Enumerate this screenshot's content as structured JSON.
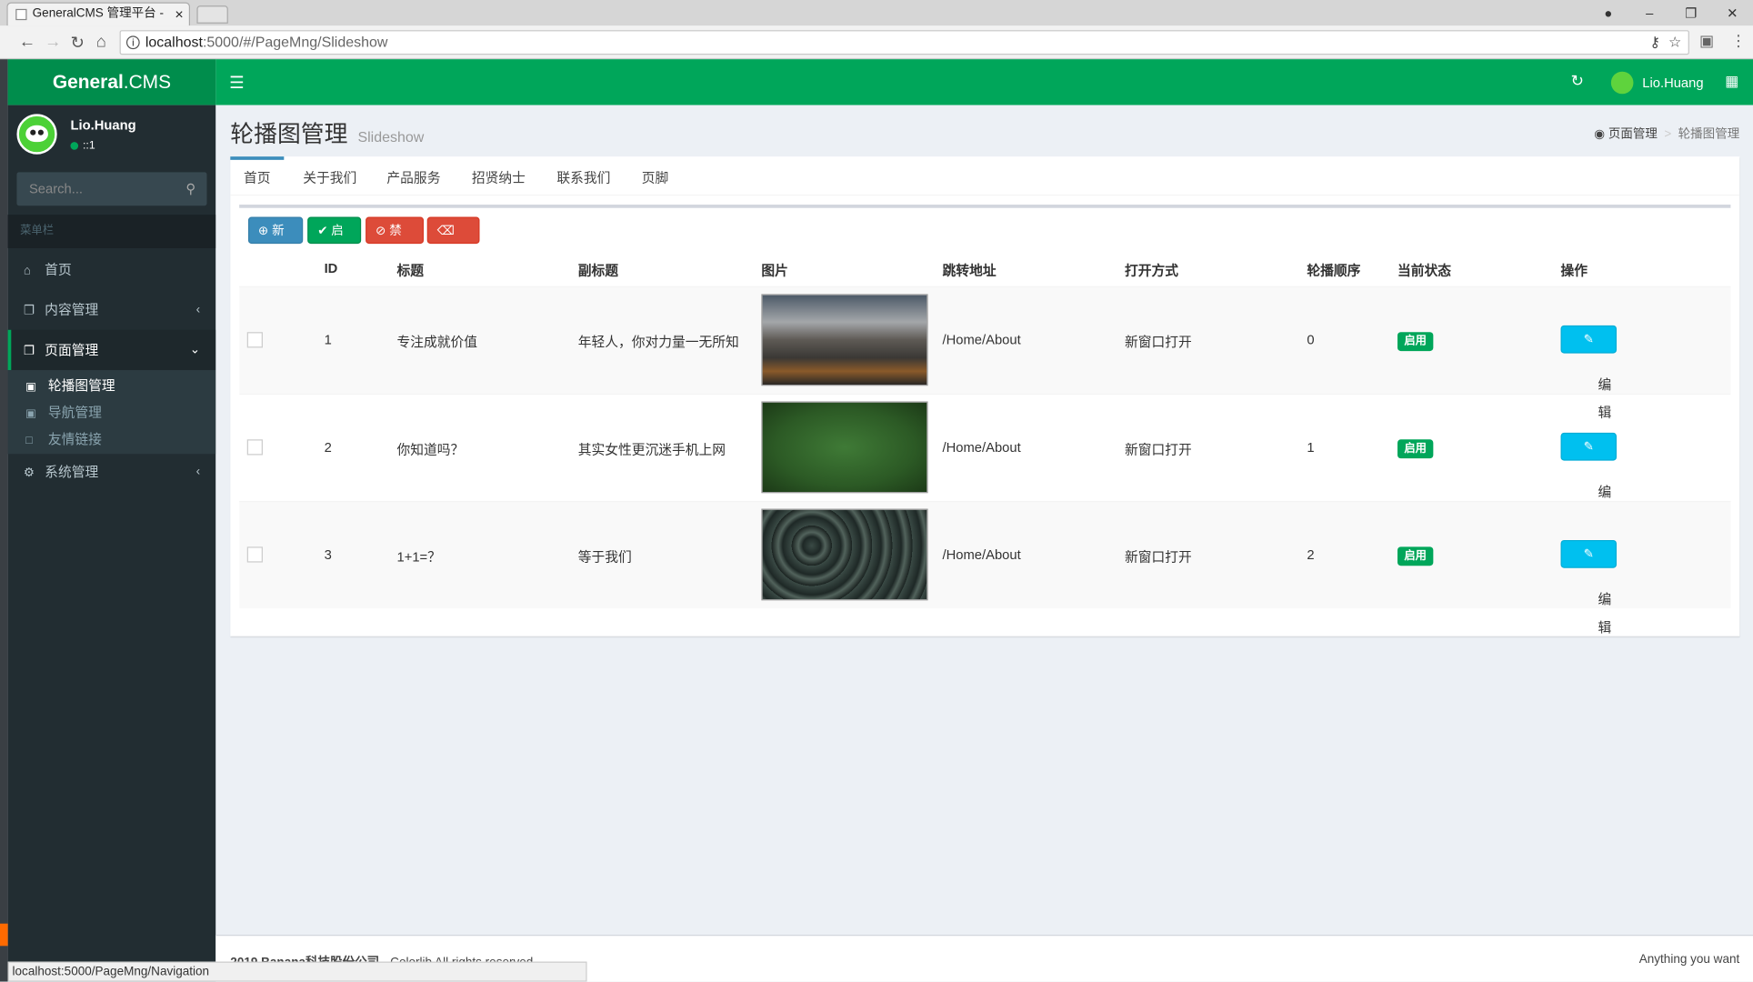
{
  "browser": {
    "tab_title": "GeneralCMS 管理平台 -",
    "tab_close": "×",
    "url_host": "localhost",
    "url_path": ":5000/#/PageMng/Slideshow",
    "status_url": "localhost:5000/PageMng/Navigation"
  },
  "app": {
    "brand_bold": "General",
    "brand_rest": ".CMS",
    "user_name": "Lio.Huang",
    "user_status": "::1",
    "search_placeholder": "Search..."
  },
  "sidebar": {
    "header": "菜单栏",
    "items": [
      {
        "label": "首页",
        "icon": "home-icon"
      },
      {
        "label": "内容管理",
        "icon": "clone-icon"
      },
      {
        "label": "页面管理",
        "icon": "clone-icon"
      },
      {
        "label": "系统管理",
        "icon": "cogs-icon"
      }
    ],
    "sub_items": [
      {
        "label": "轮播图管理",
        "icon": "image-icon"
      },
      {
        "label": "导航管理",
        "icon": "image-icon"
      },
      {
        "label": "友情链接",
        "icon": "file-icon"
      }
    ]
  },
  "page": {
    "title": "轮播图管理",
    "subtitle": "Slideshow",
    "breadcrumb": [
      "页面管理",
      "轮播图管理"
    ]
  },
  "tabs": [
    "首页",
    "关于我们",
    "产品服务",
    "招贤纳士",
    "联系我们",
    "页脚"
  ],
  "toolbar": {
    "add": "新增",
    "enable": "启用",
    "disable": "禁用",
    "delete": "删除"
  },
  "table": {
    "headers": [
      "ID",
      "标题",
      "副标题",
      "图片",
      "跳转地址",
      "打开方式",
      "轮播顺序",
      "当前状态",
      "操作"
    ],
    "rows": [
      {
        "id": "1",
        "title": "专注成就价值",
        "subtitle": "年轻人，你对力量一无所知",
        "link": "/Home/About",
        "open": "新窗口打开",
        "order": "0",
        "status": "启用",
        "action": "编辑"
      },
      {
        "id": "2",
        "title": "你知道吗？",
        "subtitle": "其实女性更沉迷手机上网",
        "link": "/Home/About",
        "open": "新窗口打开",
        "order": "1",
        "status": "启用",
        "action": "编辑"
      },
      {
        "id": "3",
        "title": "1+1=？",
        "subtitle": "等于我们",
        "link": "/Home/About",
        "open": "新窗口打开",
        "order": "2",
        "status": "启用",
        "action": "编辑"
      }
    ]
  },
  "footer": {
    "copyright": "2019 Banana科技股份公司",
    "rest": " - Colorlib All rights reserved",
    "right": "Anything you want"
  },
  "colors": {
    "accent": "#00a65a",
    "sidebar": "#222d32",
    "primary": "#3c8dbc",
    "danger": "#dd4b39",
    "info": "#00c0ef"
  }
}
